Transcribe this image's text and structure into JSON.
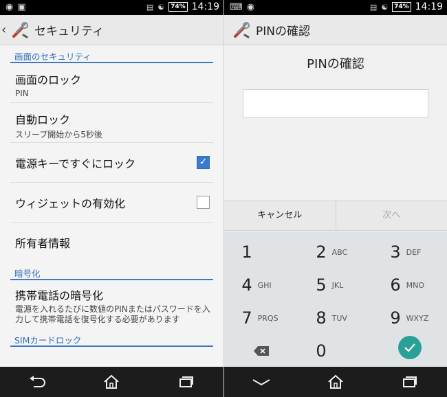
{
  "status_bar": {
    "time": "14:19",
    "battery": "74%",
    "left_icons": [
      "location-icon",
      "image-icon"
    ],
    "right_icons": [
      "vibrate-icon",
      "wifi-icon",
      "signal-icon",
      "battery-icon"
    ]
  },
  "left_screen": {
    "action_bar": {
      "title": "セキュリティ"
    },
    "sections": {
      "screen_security": "画面のセキュリティ",
      "encryption": "暗号化",
      "sim_lock": "SIMカードロック"
    },
    "items": {
      "screen_lock": {
        "title": "画面のロック",
        "summary": "PIN"
      },
      "auto_lock": {
        "title": "自動ロック",
        "summary": "スリープ開始から5秒後"
      },
      "power_lock": {
        "title": "電源キーですぐにロック",
        "checked": true
      },
      "widget": {
        "title": "ウィジェットの有効化",
        "checked": false
      },
      "owner": {
        "title": "所有者情報"
      },
      "encrypt": {
        "title": "携帯電話の暗号化",
        "summary": "電源を入れるたびに数値のPINまたはパスワードを入力して携帯電話を復号化する必要があります"
      }
    }
  },
  "right_screen": {
    "action_bar": {
      "title": "PINの確認"
    },
    "heading": "PINの確認",
    "pin_value": "",
    "buttons": {
      "cancel": "キャンセル",
      "next": "次へ"
    },
    "keys": [
      {
        "num": "1",
        "letters": ""
      },
      {
        "num": "2",
        "letters": "ABC"
      },
      {
        "num": "3",
        "letters": "DEF"
      },
      {
        "num": "4",
        "letters": "GHI"
      },
      {
        "num": "5",
        "letters": "JKL"
      },
      {
        "num": "6",
        "letters": "MNO"
      },
      {
        "num": "7",
        "letters": "PRQS"
      },
      {
        "num": "8",
        "letters": "TUV"
      },
      {
        "num": "9",
        "letters": "WXYZ"
      },
      {
        "num": "0",
        "letters": ""
      }
    ]
  },
  "colors": {
    "accent": "#2f6db8",
    "checkbox_on": "#3a7bd0",
    "ok_button": "#2aa196",
    "nav_bar": "#1c1c1c"
  }
}
